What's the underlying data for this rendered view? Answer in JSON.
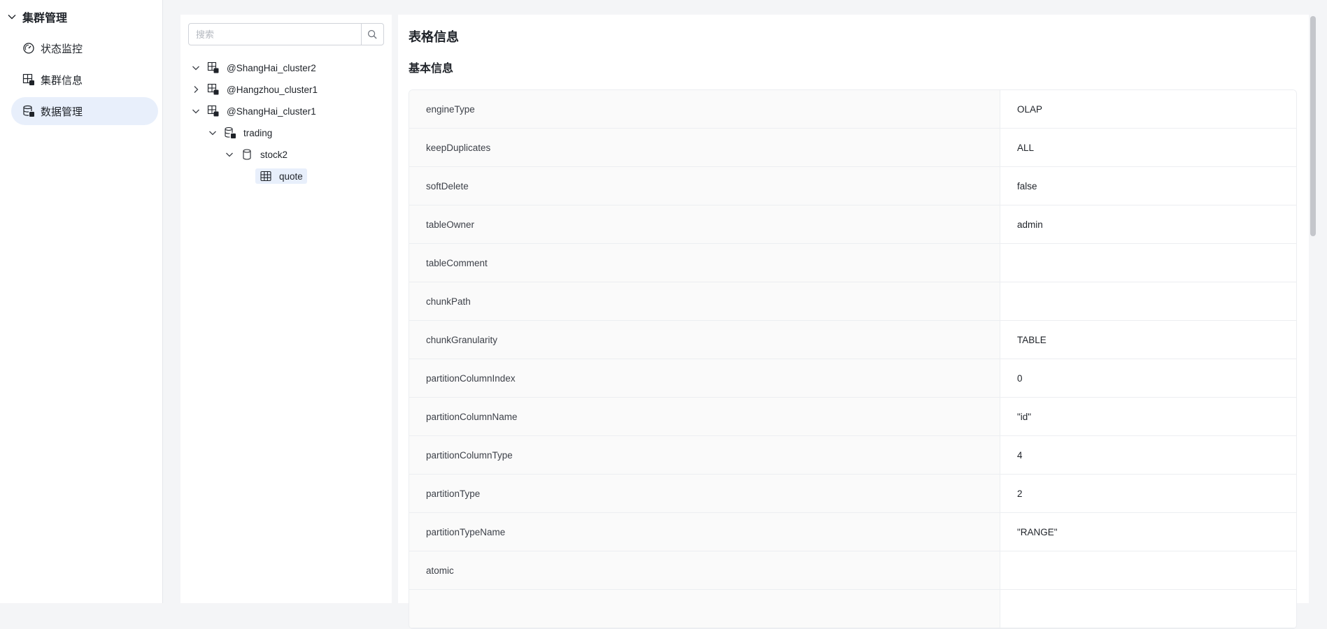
{
  "sidebar": {
    "group_title": "集群管理",
    "items": [
      {
        "label": "状态监控",
        "icon": "gauge-icon"
      },
      {
        "label": "集群信息",
        "icon": "cluster-icon"
      },
      {
        "label": "数据管理",
        "icon": "database-icon",
        "active": true
      }
    ]
  },
  "tree": {
    "search_placeholder": "搜索",
    "nodes": [
      {
        "label": "@ShangHai_cluster2",
        "expanded": true,
        "level": 0
      },
      {
        "label": "@Hangzhou_cluster1",
        "expanded": false,
        "level": 0
      },
      {
        "label": "@ShangHai_cluster1",
        "expanded": true,
        "level": 0
      },
      {
        "label": "trading",
        "expanded": true,
        "level": 1
      },
      {
        "label": "stock2",
        "expanded": true,
        "level": 2
      },
      {
        "label": "quote",
        "level": 3,
        "selected": true
      }
    ]
  },
  "content": {
    "title": "表格信息",
    "section_title": "基本信息",
    "rows": [
      {
        "key": "engineType",
        "value": "OLAP"
      },
      {
        "key": "keepDuplicates",
        "value": "ALL"
      },
      {
        "key": "softDelete",
        "value": "false"
      },
      {
        "key": "tableOwner",
        "value": "admin"
      },
      {
        "key": "tableComment",
        "value": ""
      },
      {
        "key": "chunkPath",
        "value": ""
      },
      {
        "key": "chunkGranularity",
        "value": "TABLE"
      },
      {
        "key": "partitionColumnIndex",
        "value": "0"
      },
      {
        "key": "partitionColumnName",
        "value": "\"id\""
      },
      {
        "key": "partitionColumnType",
        "value": "4"
      },
      {
        "key": "partitionType",
        "value": "2"
      },
      {
        "key": "partitionTypeName",
        "value": "\"RANGE\""
      },
      {
        "key": "atomic",
        "value": ""
      },
      {
        "key": "",
        "value": ""
      }
    ]
  },
  "colors": {
    "accent_bg": "#e8effb",
    "page_bg": "#f4f5f7"
  }
}
